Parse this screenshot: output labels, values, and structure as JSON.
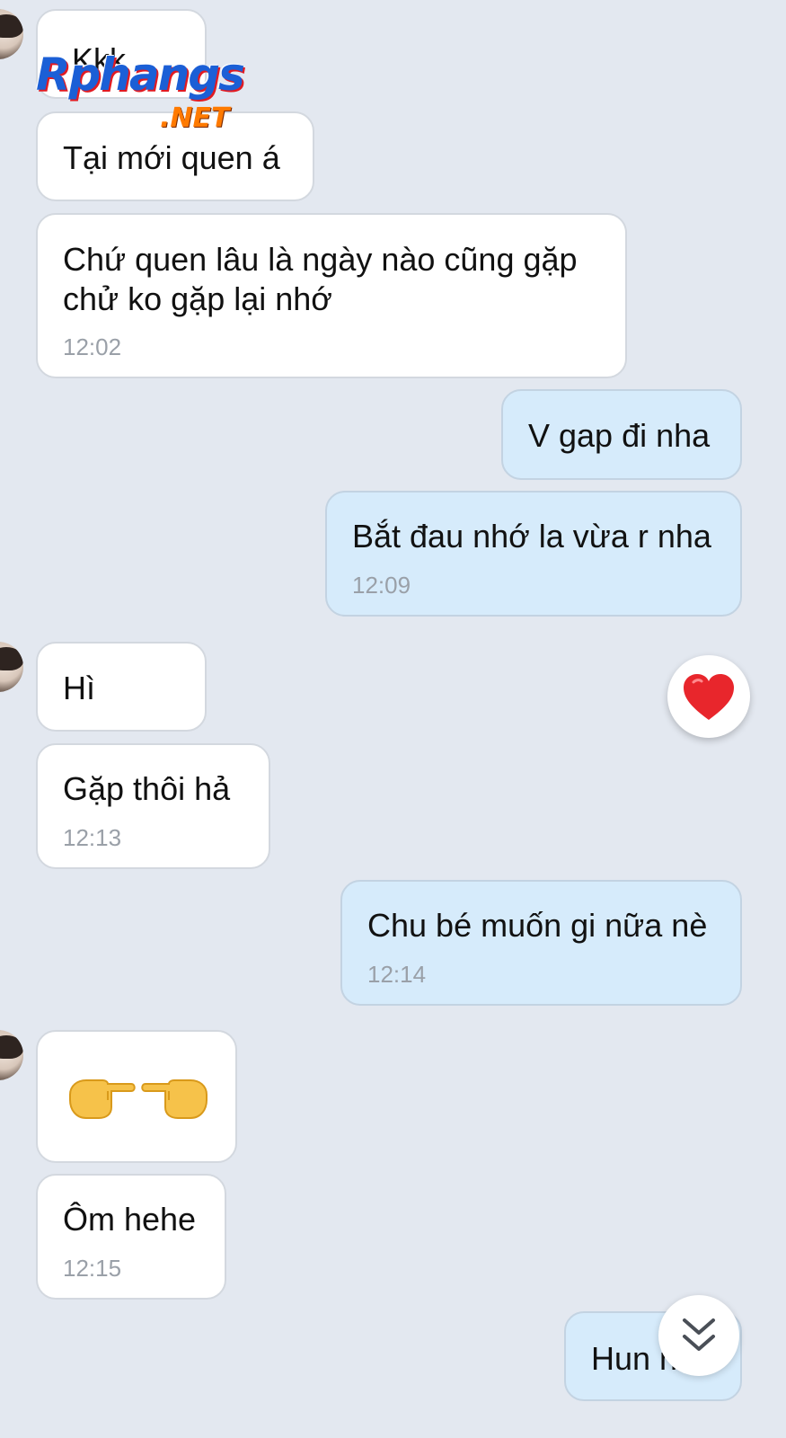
{
  "messages": [
    {
      "id": "m1",
      "side": "in",
      "text": "Kkk",
      "time": ""
    },
    {
      "id": "m2",
      "side": "in",
      "text": " Tại mới quen á",
      "time": ""
    },
    {
      "id": "m3",
      "side": "in",
      "lines": [
        "Chứ quen lâu là ngày nào cũng gặp",
        "chử ko gặp lại nhớ"
      ],
      "time": "12:02"
    },
    {
      "id": "m4",
      "side": "out",
      "text": "V gap đi nha",
      "time": ""
    },
    {
      "id": "m5",
      "side": "out",
      "text": "Bắt đau nhớ la vừa r nha",
      "time": "12:09"
    },
    {
      "id": "m6",
      "side": "in",
      "text": "Hì",
      "time": ""
    },
    {
      "id": "m7",
      "side": "in",
      "text": " Gặp thôi hả",
      "time": "12:13"
    },
    {
      "id": "m8",
      "side": "out",
      "text": "Chu bé muốn gi nữa nè",
      "time": "12:14"
    },
    {
      "id": "m9",
      "side": "in",
      "emoji": [
        "point-right-emoji",
        "point-left-emoji"
      ],
      "time": ""
    },
    {
      "id": "m10",
      "side": "in",
      "text": "Ôm hehe",
      "time": "12:15"
    },
    {
      "id": "m11",
      "side": "out",
      "text": "Hun nua",
      "time": ""
    }
  ],
  "reaction": {
    "icon": "heart-icon",
    "color": "#e8262c"
  },
  "scroll_button": {
    "icon": "double-chevron-down-icon"
  },
  "watermark": {
    "main": "Rphangs",
    "sub": ".NET"
  },
  "colors": {
    "background": "#e3e8f0",
    "incoming_bubble": "#ffffff",
    "outgoing_bubble": "#d6ebfb",
    "timestamp": "#9aa0a8"
  }
}
